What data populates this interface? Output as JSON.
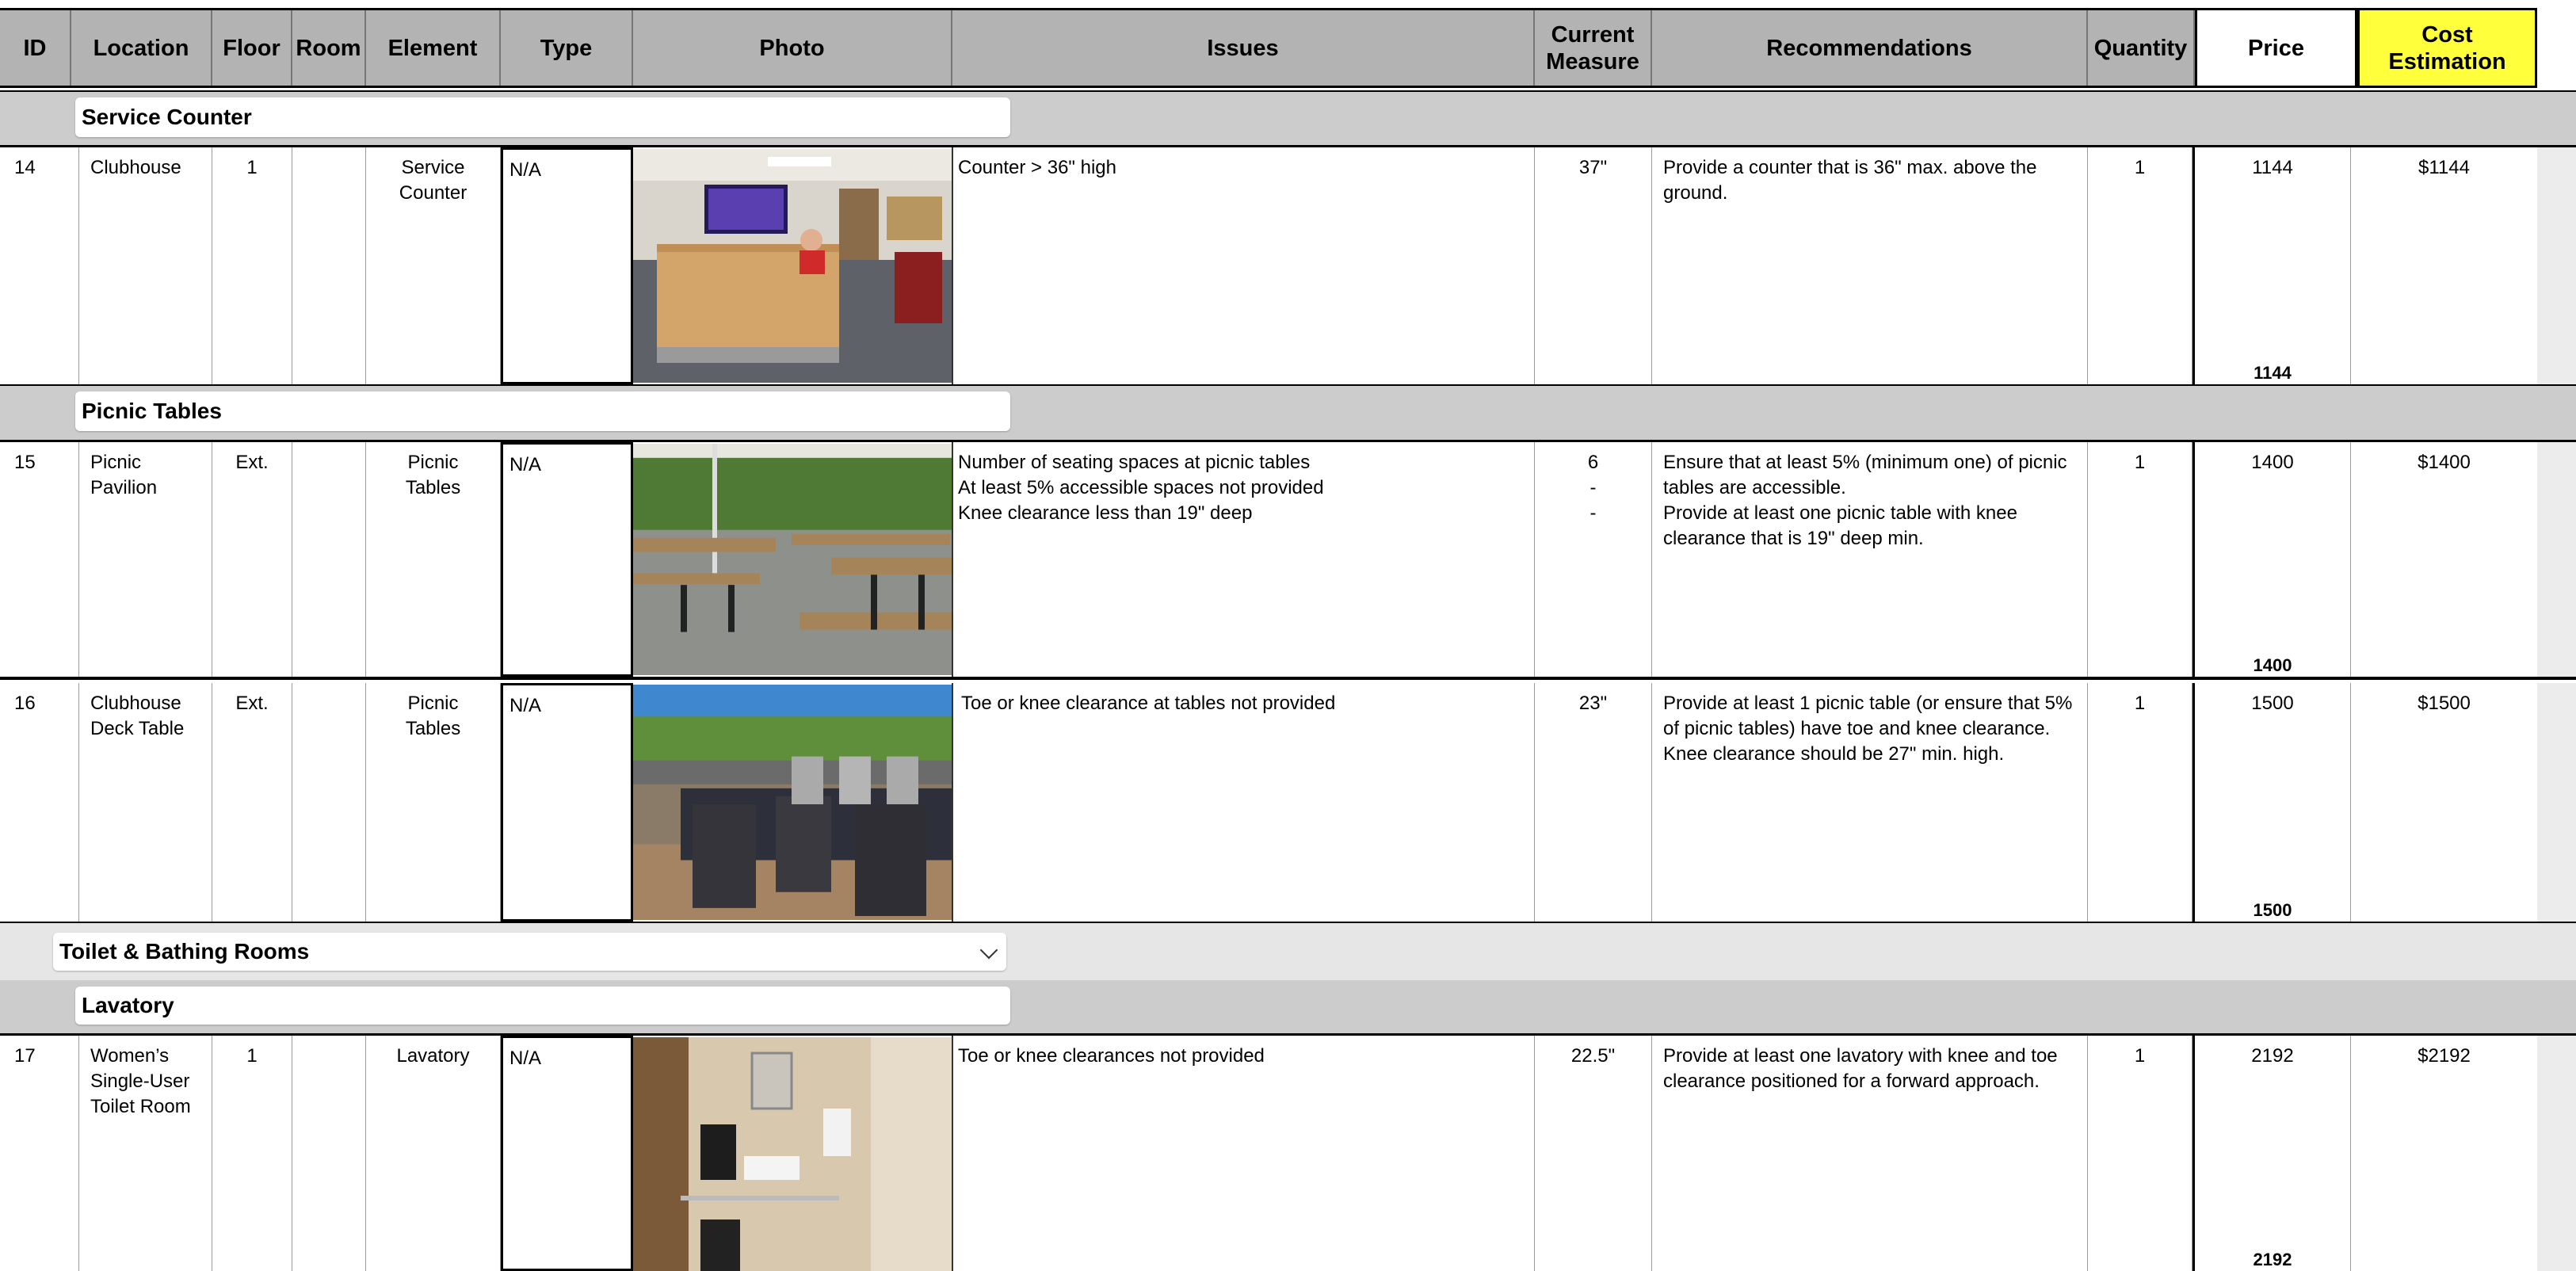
{
  "columns": {
    "id": "ID",
    "location": "Location",
    "floor": "Floor",
    "room": "Room",
    "element": "Element",
    "type": "Type",
    "photo": "Photo",
    "issues": "Issues",
    "current_measure": "Current Measure",
    "recommendations": "Recommendations",
    "quantity": "Quantity",
    "price": "Price",
    "cost_estimation": "Cost Estimation"
  },
  "groups": {
    "service_counter": "Service Counter",
    "picnic_tables": "Picnic Tables",
    "toilet_bathing": "Toilet & Bathing Rooms",
    "lavatory": "Lavatory"
  },
  "rows": [
    {
      "id": "14",
      "location": "Clubhouse",
      "floor": "1",
      "room": "",
      "element": "Service Counter",
      "type": "N/A",
      "issues": [
        "Counter > 36\" high"
      ],
      "current_measure": [
        "37\""
      ],
      "recommendations": [
        "Provide a counter that is 36\" max. above the",
        "ground."
      ],
      "quantity": "1",
      "price": "1144",
      "subtotal": "1144",
      "cost": "$1144"
    },
    {
      "id": "15",
      "location": "Picnic Pavilion",
      "floor": "Ext.",
      "room": "",
      "element": "Picnic Tables",
      "type": "N/A",
      "issues": [
        "Number of seating spaces at picnic tables",
        "At least 5% accessible spaces not provided",
        "Knee clearance less than 19\" deep"
      ],
      "current_measure": [
        "6",
        "-",
        "-"
      ],
      "recommendations": [
        "Ensure that at least 5% (minimum one) of picnic",
        "tables are accessible.",
        "Provide at least one picnic table with knee",
        "clearance that is 19\" deep min."
      ],
      "quantity": "1",
      "price": "1400",
      "subtotal": "1400",
      "cost": "$1400"
    },
    {
      "id": "16",
      "location": "Clubhouse Deck Table",
      "floor": "Ext.",
      "room": "",
      "element": "Picnic Tables",
      "type": "N/A",
      "issues": [
        "Toe or knee clearance at tables not provided"
      ],
      "current_measure": [
        "23\""
      ],
      "recommendations": [
        "Provide at least 1 picnic table (or ensure that 5%",
        "of picnic tables) have toe and knee clearance.",
        "Knee clearance should be 27\" min. high."
      ],
      "quantity": "1",
      "price": "1500",
      "subtotal": "1500",
      "cost": "$1500"
    },
    {
      "id": "17",
      "location": "Women’s Single-User Toilet Room",
      "floor": "1",
      "room": "",
      "element": "Lavatory",
      "type": "N/A",
      "issues": [
        "Toe or knee clearances not provided"
      ],
      "current_measure": [
        "22.5\""
      ],
      "recommendations": [
        "Provide at least one lavatory with knee and toe",
        "clearance positioned for a forward approach."
      ],
      "quantity": "1",
      "price": "2192",
      "subtotal": "2192",
      "cost": "$2192"
    }
  ],
  "icons": {
    "group_toggle": "chevron-down-icon"
  },
  "colors": {
    "header_bg": "#b3b3b3",
    "cost_header_bg": "#ffff3b",
    "group_bg": "#cccccc",
    "section_bg": "#e6e6e6"
  }
}
